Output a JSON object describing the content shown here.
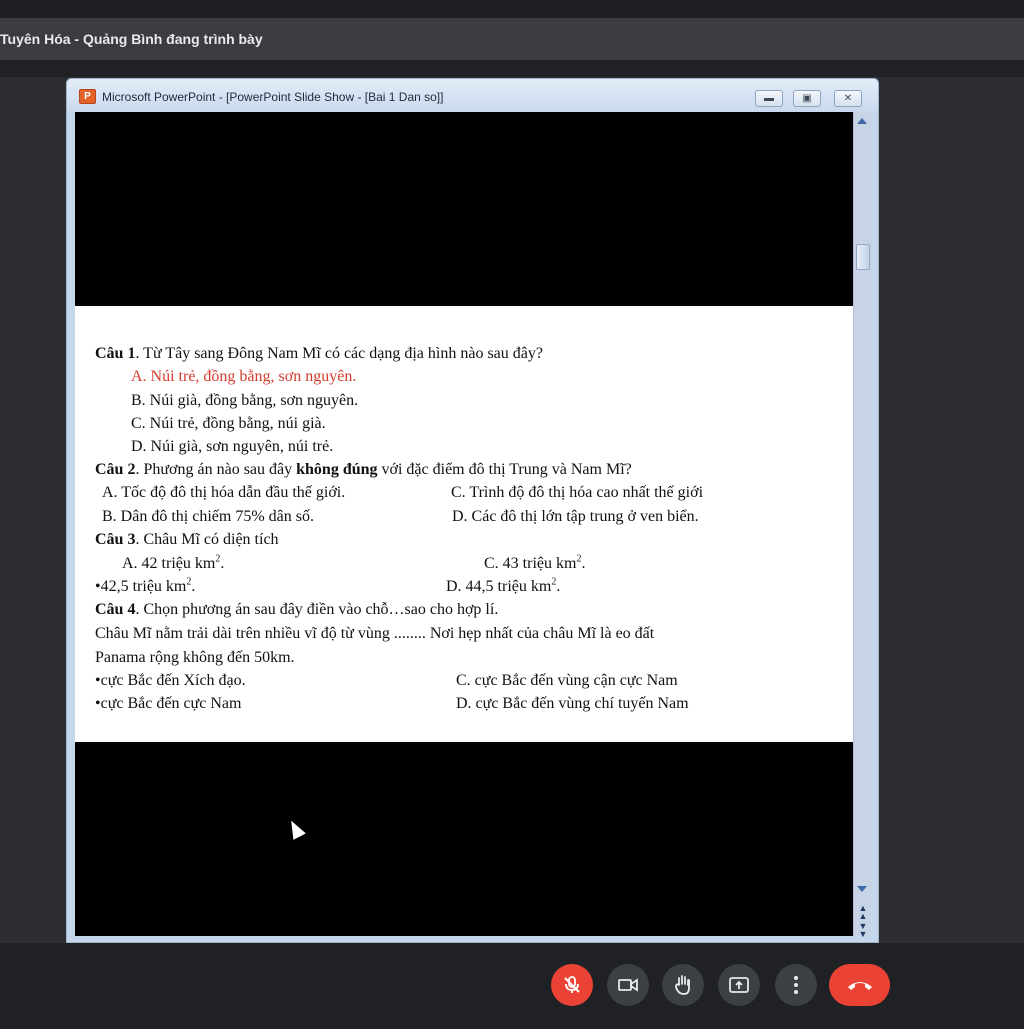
{
  "meeting": {
    "presenter_banner": "Tuyên Hóa - Quảng Bình đang trình bày"
  },
  "window": {
    "title": "Microsoft PowerPoint - [PowerPoint Slide Show - [Bai 1 Dan so]]",
    "icon_label": "P"
  },
  "slide": {
    "lines": {
      "q1_label": "Câu 1",
      "q1_text": ". Từ Tây sang Đông Nam Mĩ có các dạng địa hình nào sau đây?",
      "q1_a": "A. Núi trẻ, đồng bằng, sơn nguyên.",
      "q1_b": "B. Núi già, đồng bằng, sơn nguyên.",
      "q1_c": "C. Núi trẻ, đồng bằng, núi già.",
      "q1_d": "D. Núi già, sơn nguyên, núi trẻ.",
      "q2_label": "Câu 2",
      "q2_text_pre": ". Phương án nào sau đây ",
      "q2_bold": "không đúng",
      "q2_text_post": " với đặc điểm đô thị Trung và Nam Mĩ?",
      "q2_a": "A. Tốc độ đô thị hóa dẫn đầu thế giới.",
      "q2_c": "C. Trình độ đô thị hóa cao nhất thế giới",
      "q2_b": "B. Dân đô thị chiếm 75% dân số.",
      "q2_d": "D. Các đô thị lớn tập trung ở ven biển.",
      "q3_label": "Câu 3",
      "q3_text": ". Châu Mĩ có diện tích",
      "q3_a": "A. 42 triệu km",
      "q3_c": "C. 43 triệu km",
      "q3_b": "•42,5  triệu km",
      "q3_d": "D. 44,5 triệu km",
      "sq": "2",
      "dot": ".",
      "q4_label": "Câu 4",
      "q4_text": ".  Chọn phương án sau đây điền vào chỗ…sao cho hợp lí.",
      "q4_body1": "Châu Mĩ nằm trải dài trên nhiều vĩ độ từ vùng ........ Nơi hẹp nhất của châu Mĩ là eo đất",
      "q4_body2": "Panama rộng không đến 50km.",
      "q4_a": "•cực Bắc đến Xích đạo.",
      "q4_c": "C. cực Bắc đến vùng cận cực Nam",
      "q4_b": "•cực Bắc đến cực Nam",
      "q4_d": "D. cực Bắc đến vùng chí tuyến Nam"
    }
  },
  "colors": {
    "answer_highlight": "#d43b2e",
    "end_call": "#ea4335"
  },
  "controls": {
    "icons": [
      "mic-off-icon",
      "camera-icon",
      "raise-hand-icon",
      "present-icon",
      "more-icon",
      "end-call-icon"
    ]
  }
}
